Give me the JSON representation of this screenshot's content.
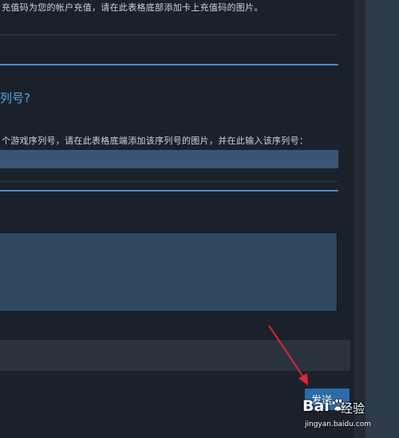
{
  "top_text": "充值码为您的帐户充值，请在此表格底部添加卡上充值码的图片。",
  "section": {
    "title": "列号?",
    "instruction": "个游戏序列号，请在此表格底端添加该序列号的图片，并在此输入该序列号："
  },
  "serial_field": {
    "value": "",
    "placeholder": ""
  },
  "message_field": {
    "value": ""
  },
  "send_button": {
    "label": "发送"
  },
  "watermark": {
    "logo_left": "Bai",
    "logo_right": "经验",
    "url": "jingyan.baidu.com"
  },
  "colors": {
    "background": "#171c24",
    "panel": "#1b212b",
    "accent": "#4a8cc4",
    "title": "#5aa8e0",
    "input": "#3a5574",
    "button": "#2c6aa8",
    "annotation_arrow": "#e0282e"
  },
  "icons": [
    "red-arrow-annotation-icon",
    "baidu-paw-icon"
  ]
}
